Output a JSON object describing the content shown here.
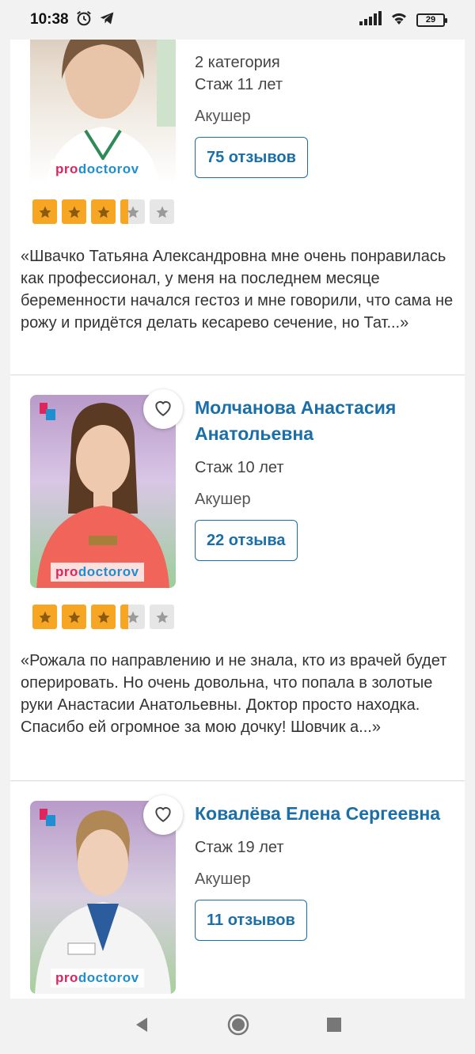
{
  "status_bar": {
    "time": "10:38",
    "battery": "29"
  },
  "doctors": [
    {
      "category": "2 категория",
      "experience": "Стаж 11 лет",
      "specialty": "Акушер",
      "reviews_label": "75 отзывов",
      "rating": 3.5,
      "quote": "«Швачко Татьяна Александровна мне очень понравилась как профессионал, у меня на последнем месяце беременности начался гестоз и мне говорили, что сама не рожу и придётся делать кесарево сечение, но Тат...»",
      "watermark": "prodoctorov"
    },
    {
      "name": "Молчанова Анастасия Анатольевна",
      "experience": "Стаж 10 лет",
      "specialty": "Акушер",
      "reviews_label": "22 отзыва",
      "rating": 3.5,
      "quote": "«Рожала по направлению и не знала, кто из врачей будет оперировать. Но очень довольна, что попала в золотые руки Анастасии Анатольевны. Доктор просто находка. Спасибо ей огромное за мою дочку! Шовчик а...»",
      "watermark": "prodoctorov"
    },
    {
      "name": "Ковалёва Елена Сергеевна",
      "experience": "Стаж 19 лет",
      "specialty": "Акушер",
      "reviews_label": "11 отзывов",
      "watermark": "prodoctorov"
    }
  ],
  "colors": {
    "accent": "#1a6fa8",
    "star_on": "#f6a623",
    "star_off": "#e6e6e6"
  },
  "icons": [
    "alarm-icon",
    "telegram-icon",
    "signal-icon",
    "wifi-icon",
    "heart-icon",
    "star-icon",
    "back-icon",
    "home-icon",
    "recents-icon"
  ]
}
